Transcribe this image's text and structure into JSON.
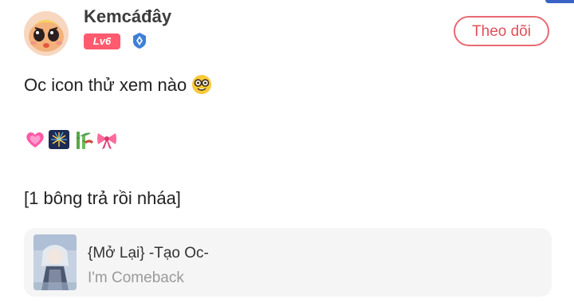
{
  "post": {
    "author": {
      "name": "Kemcáđây",
      "level": "Lv6"
    },
    "follow_label": "Theo dõi",
    "line1": "Oc icon thử xem nào",
    "line3": "[1 bông trả rồi nháa]",
    "emojis": [
      "heart-emoji",
      "fireworks-emoji",
      "bamboo-emoji",
      "ribbon-emoji"
    ],
    "linked_post": {
      "title": "{Mở Lại} -Tạo Oc-",
      "subtitle": "I'm Comeback"
    }
  },
  "colors": {
    "accent": "#e86a73",
    "level_badge": "#ff5a6e",
    "verified": "#3f7fd8",
    "card_bg": "#f5f5f6"
  }
}
